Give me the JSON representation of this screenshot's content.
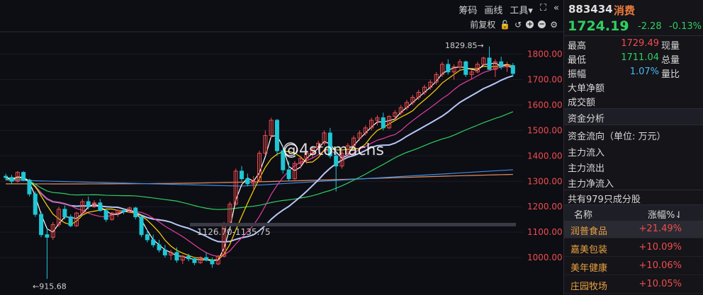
{
  "toolbar": {
    "items": [
      "筹码",
      "画线",
      "工具▾"
    ],
    "sub_label": "前复权"
  },
  "chart": {
    "watermark": "@4stomachs",
    "high_label": "1829.85→",
    "low_label": "←915.68",
    "range_label": "1126.70-1135.75",
    "y_ticks": [
      "1800.00",
      "1700.00",
      "1600.00",
      "1500.00",
      "1400.00",
      "1300.00",
      "1200.00",
      "1100.00",
      "1000.00"
    ],
    "colors": {
      "up": "#ef4d4d",
      "down": "#1fc7d4",
      "ma5": "#ffffff",
      "ma10": "#ffd400",
      "ma20": "#e040a0",
      "ma30": "#b8c8f8",
      "ma60": "#2ecf60",
      "ma120": "#3a8ee6",
      "ma250": "#e89060"
    }
  },
  "chart_data": {
    "type": "candlestick",
    "y_range": [
      900,
      1860
    ],
    "candles_ohlc": [
      [
        1320,
        1330,
        1305,
        1315
      ],
      [
        1315,
        1325,
        1290,
        1300
      ],
      [
        1300,
        1340,
        1295,
        1335
      ],
      [
        1335,
        1340,
        1300,
        1305
      ],
      [
        1305,
        1310,
        1240,
        1250
      ],
      [
        1250,
        1260,
        1160,
        1170
      ],
      [
        1170,
        1180,
        1080,
        1090
      ],
      [
        1090,
        1120,
        916,
        1080
      ],
      [
        1080,
        1140,
        1070,
        1130
      ],
      [
        1130,
        1200,
        1120,
        1190
      ],
      [
        1190,
        1205,
        1150,
        1160
      ],
      [
        1160,
        1170,
        1120,
        1125
      ],
      [
        1125,
        1180,
        1120,
        1175
      ],
      [
        1175,
        1230,
        1170,
        1220
      ],
      [
        1220,
        1240,
        1190,
        1200
      ],
      [
        1200,
        1225,
        1195,
        1215
      ],
      [
        1215,
        1230,
        1180,
        1185
      ],
      [
        1185,
        1190,
        1140,
        1150
      ],
      [
        1150,
        1180,
        1145,
        1175
      ],
      [
        1175,
        1190,
        1160,
        1185
      ],
      [
        1185,
        1195,
        1170,
        1180
      ],
      [
        1180,
        1200,
        1175,
        1195
      ],
      [
        1195,
        1200,
        1150,
        1160
      ],
      [
        1160,
        1165,
        1080,
        1090
      ],
      [
        1090,
        1110,
        1060,
        1070
      ],
      [
        1070,
        1090,
        1040,
        1050
      ],
      [
        1050,
        1070,
        1020,
        1030
      ],
      [
        1030,
        1050,
        1000,
        1010
      ],
      [
        1010,
        1030,
        990,
        1020
      ],
      [
        1020,
        1040,
        980,
        990
      ],
      [
        990,
        1010,
        975,
        1005
      ],
      [
        1005,
        1015,
        985,
        995
      ],
      [
        995,
        1000,
        970,
        980
      ],
      [
        980,
        1005,
        975,
        1000
      ],
      [
        1000,
        1020,
        985,
        990
      ],
      [
        990,
        1000,
        960,
        975
      ],
      [
        975,
        1010,
        970,
        1005
      ],
      [
        1005,
        1140,
        1000,
        1130
      ],
      [
        1130,
        1220,
        1120,
        1210
      ],
      [
        1210,
        1350,
        1205,
        1340
      ],
      [
        1340,
        1360,
        1300,
        1310
      ],
      [
        1310,
        1330,
        1280,
        1290
      ],
      [
        1290,
        1320,
        1270,
        1300
      ],
      [
        1300,
        1420,
        1295,
        1410
      ],
      [
        1410,
        1500,
        1400,
        1480
      ],
      [
        1480,
        1550,
        1470,
        1540
      ],
      [
        1540,
        1545,
        1400,
        1420
      ],
      [
        1420,
        1440,
        1330,
        1345
      ],
      [
        1345,
        1380,
        1300,
        1310
      ],
      [
        1310,
        1380,
        1305,
        1370
      ],
      [
        1370,
        1400,
        1350,
        1390
      ],
      [
        1390,
        1420,
        1370,
        1410
      ],
      [
        1410,
        1440,
        1390,
        1430
      ],
      [
        1430,
        1460,
        1420,
        1450
      ],
      [
        1450,
        1500,
        1440,
        1490
      ],
      [
        1490,
        1510,
        1390,
        1400
      ],
      [
        1400,
        1420,
        1260,
        1360
      ],
      [
        1360,
        1420,
        1350,
        1410
      ],
      [
        1410,
        1450,
        1400,
        1440
      ],
      [
        1440,
        1480,
        1430,
        1470
      ],
      [
        1470,
        1500,
        1460,
        1490
      ],
      [
        1490,
        1520,
        1480,
        1510
      ],
      [
        1510,
        1550,
        1500,
        1540
      ],
      [
        1540,
        1560,
        1520,
        1550
      ],
      [
        1550,
        1570,
        1500,
        1510
      ],
      [
        1510,
        1560,
        1505,
        1555
      ],
      [
        1555,
        1580,
        1540,
        1570
      ],
      [
        1570,
        1600,
        1560,
        1590
      ],
      [
        1590,
        1620,
        1580,
        1610
      ],
      [
        1610,
        1640,
        1600,
        1630
      ],
      [
        1630,
        1660,
        1620,
        1650
      ],
      [
        1650,
        1680,
        1640,
        1670
      ],
      [
        1670,
        1700,
        1660,
        1690
      ],
      [
        1690,
        1730,
        1680,
        1720
      ],
      [
        1720,
        1770,
        1710,
        1760
      ],
      [
        1760,
        1780,
        1720,
        1730
      ],
      [
        1730,
        1760,
        1700,
        1750
      ],
      [
        1750,
        1780,
        1740,
        1770
      ],
      [
        1770,
        1775,
        1710,
        1720
      ],
      [
        1720,
        1740,
        1700,
        1730
      ],
      [
        1730,
        1770,
        1725,
        1760
      ],
      [
        1760,
        1790,
        1750,
        1785
      ],
      [
        1785,
        1830,
        1770,
        1740
      ],
      [
        1740,
        1780,
        1710,
        1770
      ],
      [
        1770,
        1790,
        1740,
        1750
      ],
      [
        1750,
        1770,
        1730,
        1755
      ],
      [
        1755,
        1765,
        1711,
        1724
      ]
    ]
  },
  "side": {
    "code": "883434",
    "name": "消费",
    "price": "1724.19",
    "arrow": "⬇",
    "change": "-2.28",
    "change_pct": "-0.13%",
    "high_label": "最高",
    "high_val": "1729.49",
    "now_label": "现量",
    "low_label": "最低",
    "low_val": "1711.04",
    "total_label": "总量",
    "amp_label": "振幅",
    "amp_val": "1.07%",
    "ratio_label": "量比",
    "big_net_label": "大单净额",
    "turnover_label": "成交额",
    "flow_section": "资金分析",
    "flow_unit_label": "资金流向（单位: 万元）",
    "flow_in_label": "主力流入",
    "flow_out_label": "主力流出",
    "flow_net_label": "主力净流入",
    "constituents_label": "共有979只成分股",
    "col_name": "名称",
    "col_pct": "涨幅%⇃",
    "stocks": [
      {
        "name": "润普食品",
        "pct": "+21.49%"
      },
      {
        "name": "嘉美包装",
        "pct": "+10.09%"
      },
      {
        "name": "美年健康",
        "pct": "+10.06%"
      },
      {
        "name": "庄园牧场",
        "pct": "+10.05%"
      }
    ]
  }
}
